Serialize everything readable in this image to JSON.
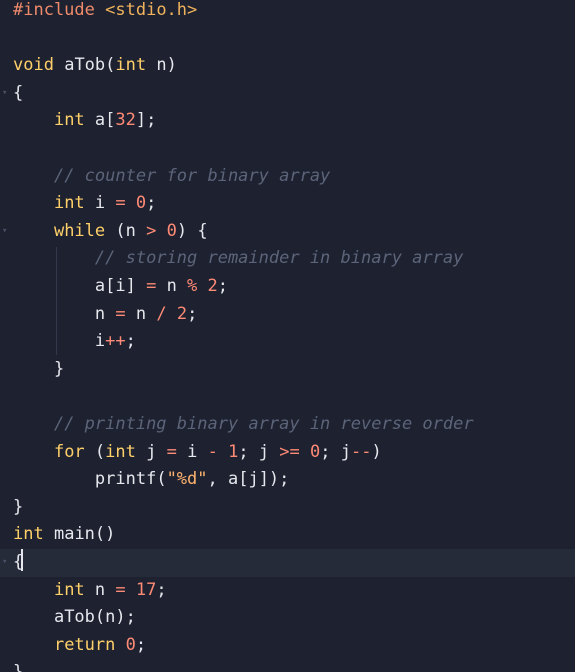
{
  "editor": {
    "lines": [
      {
        "tokens": [
          {
            "t": "#include",
            "k": "directive"
          },
          {
            "t": " ",
            "k": "punct"
          },
          {
            "t": "<stdio.h>",
            "k": "header"
          }
        ]
      },
      {
        "tokens": []
      },
      {
        "tokens": [
          {
            "t": "void",
            "k": "type"
          },
          {
            "t": " ",
            "k": "punct"
          },
          {
            "t": "aTob",
            "k": "func"
          },
          {
            "t": "(",
            "k": "punct"
          },
          {
            "t": "int",
            "k": "type"
          },
          {
            "t": " n)",
            "k": "ident"
          }
        ]
      },
      {
        "fold": "▾",
        "tokens": [
          {
            "t": "{",
            "k": "punct"
          }
        ]
      },
      {
        "tokens": [
          {
            "t": "    ",
            "k": "punct"
          },
          {
            "t": "int",
            "k": "type"
          },
          {
            "t": " a[",
            "k": "ident"
          },
          {
            "t": "32",
            "k": "number"
          },
          {
            "t": "];",
            "k": "punct"
          }
        ]
      },
      {
        "tokens": []
      },
      {
        "tokens": [
          {
            "t": "    ",
            "k": "punct"
          },
          {
            "t": "// counter for binary array",
            "k": "comment"
          }
        ]
      },
      {
        "tokens": [
          {
            "t": "    ",
            "k": "punct"
          },
          {
            "t": "int",
            "k": "type"
          },
          {
            "t": " i ",
            "k": "ident"
          },
          {
            "t": "=",
            "k": "op"
          },
          {
            "t": " ",
            "k": "punct"
          },
          {
            "t": "0",
            "k": "number"
          },
          {
            "t": ";",
            "k": "punct"
          }
        ]
      },
      {
        "fold": "▾",
        "tokens": [
          {
            "t": "    ",
            "k": "punct"
          },
          {
            "t": "while",
            "k": "keyword"
          },
          {
            "t": " (n ",
            "k": "ident"
          },
          {
            "t": ">",
            "k": "op"
          },
          {
            "t": " ",
            "k": "punct"
          },
          {
            "t": "0",
            "k": "number"
          },
          {
            "t": ") {",
            "k": "punct"
          }
        ]
      },
      {
        "tokens": [
          {
            "t": "        ",
            "k": "punct"
          },
          {
            "t": "// storing remainder in binary array",
            "k": "comment"
          }
        ]
      },
      {
        "tokens": [
          {
            "t": "        ",
            "k": "punct"
          },
          {
            "t": "a[i] ",
            "k": "ident"
          },
          {
            "t": "=",
            "k": "op"
          },
          {
            "t": " n ",
            "k": "ident"
          },
          {
            "t": "%",
            "k": "op"
          },
          {
            "t": " ",
            "k": "punct"
          },
          {
            "t": "2",
            "k": "number"
          },
          {
            "t": ";",
            "k": "punct"
          }
        ]
      },
      {
        "tokens": [
          {
            "t": "        ",
            "k": "punct"
          },
          {
            "t": "n ",
            "k": "ident"
          },
          {
            "t": "=",
            "k": "op"
          },
          {
            "t": " n ",
            "k": "ident"
          },
          {
            "t": "/",
            "k": "op"
          },
          {
            "t": " ",
            "k": "punct"
          },
          {
            "t": "2",
            "k": "number"
          },
          {
            "t": ";",
            "k": "punct"
          }
        ]
      },
      {
        "tokens": [
          {
            "t": "        ",
            "k": "punct"
          },
          {
            "t": "i",
            "k": "ident"
          },
          {
            "t": "++",
            "k": "op"
          },
          {
            "t": ";",
            "k": "punct"
          }
        ]
      },
      {
        "tokens": [
          {
            "t": "    ",
            "k": "punct"
          },
          {
            "t": "}",
            "k": "punct"
          }
        ]
      },
      {
        "tokens": []
      },
      {
        "tokens": [
          {
            "t": "    ",
            "k": "punct"
          },
          {
            "t": "// printing binary array in reverse order",
            "k": "comment"
          }
        ]
      },
      {
        "tokens": [
          {
            "t": "    ",
            "k": "punct"
          },
          {
            "t": "for",
            "k": "keyword"
          },
          {
            "t": " (",
            "k": "punct"
          },
          {
            "t": "int",
            "k": "type"
          },
          {
            "t": " j ",
            "k": "ident"
          },
          {
            "t": "=",
            "k": "op"
          },
          {
            "t": " i ",
            "k": "ident"
          },
          {
            "t": "-",
            "k": "op"
          },
          {
            "t": " ",
            "k": "punct"
          },
          {
            "t": "1",
            "k": "number"
          },
          {
            "t": "; j ",
            "k": "ident"
          },
          {
            "t": ">=",
            "k": "op"
          },
          {
            "t": " ",
            "k": "punct"
          },
          {
            "t": "0",
            "k": "number"
          },
          {
            "t": "; j",
            "k": "ident"
          },
          {
            "t": "--",
            "k": "op"
          },
          {
            "t": ")",
            "k": "punct"
          }
        ]
      },
      {
        "tokens": [
          {
            "t": "        ",
            "k": "punct"
          },
          {
            "t": "printf",
            "k": "func"
          },
          {
            "t": "(",
            "k": "punct"
          },
          {
            "t": "\"%d\"",
            "k": "string"
          },
          {
            "t": ", a[j]);",
            "k": "ident"
          }
        ]
      },
      {
        "tokens": [
          {
            "t": "}",
            "k": "punct"
          }
        ]
      },
      {
        "tokens": [
          {
            "t": "int",
            "k": "type"
          },
          {
            "t": " ",
            "k": "punct"
          },
          {
            "t": "main",
            "k": "func"
          },
          {
            "t": "()",
            "k": "punct"
          }
        ]
      },
      {
        "fold": "▾",
        "active": true,
        "tokens": [
          {
            "t": "{",
            "k": "punct"
          }
        ]
      },
      {
        "tokens": [
          {
            "t": "    ",
            "k": "punct"
          },
          {
            "t": "int",
            "k": "type"
          },
          {
            "t": " n ",
            "k": "ident"
          },
          {
            "t": "=",
            "k": "op"
          },
          {
            "t": " ",
            "k": "punct"
          },
          {
            "t": "17",
            "k": "number"
          },
          {
            "t": ";",
            "k": "punct"
          }
        ]
      },
      {
        "tokens": [
          {
            "t": "    ",
            "k": "punct"
          },
          {
            "t": "aTob",
            "k": "func"
          },
          {
            "t": "(n);",
            "k": "ident"
          }
        ]
      },
      {
        "tokens": [
          {
            "t": "    ",
            "k": "punct"
          },
          {
            "t": "return",
            "k": "keyword"
          },
          {
            "t": " ",
            "k": "punct"
          },
          {
            "t": "0",
            "k": "number"
          },
          {
            "t": ";",
            "k": "punct"
          }
        ]
      },
      {
        "tokens": [
          {
            "t": "}",
            "k": "punct"
          }
        ]
      }
    ]
  }
}
